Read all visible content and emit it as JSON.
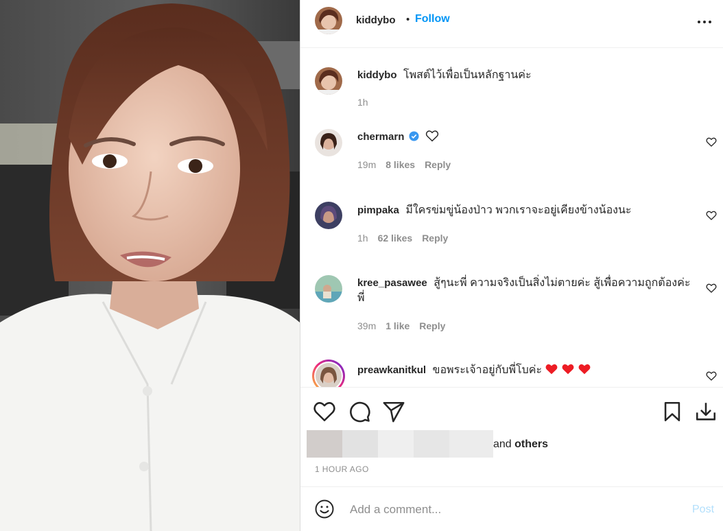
{
  "header": {
    "username": "kiddybo",
    "separator": "•",
    "follow_label": "Follow",
    "more_icon": "more-horizontal-icon"
  },
  "caption": {
    "username": "kiddybo",
    "text": "โพสต์ไว้เพื่อเป็นหลักฐานค่ะ",
    "time": "1h"
  },
  "comments": [
    {
      "username": "chermarn",
      "text": "",
      "verified": true,
      "emoji": "outline-heart",
      "time": "19m",
      "likes": "8 likes",
      "reply": "Reply"
    },
    {
      "username": "pimpaka",
      "text": "มีใครข่มขู่น้องป่าว พวกเราจะอยู่เคียงข้างน้องนะ",
      "time": "1h",
      "likes": "62 likes",
      "reply": "Reply"
    },
    {
      "username": "kree_pasawee",
      "text": "สู้ๆนะพี่ ความจริงเป็นสิ่งไม่ตายค่ะ สู้เพื่อความถูกต้องค่ะพี่",
      "time": "39m",
      "likes": "1 like",
      "reply": "Reply"
    },
    {
      "username": "preawkanitkul",
      "text": "ขอพระเจ้าอยู่กับพี่โบค่ะ",
      "emoji": "red-hearts",
      "time": "",
      "likes": "",
      "reply": ""
    }
  ],
  "actions": {
    "like_icon": "heart-icon",
    "comment_icon": "comment-icon",
    "share_icon": "send-icon",
    "save_icon": "bookmark-icon",
    "download_icon": "download-icon"
  },
  "likes": {
    "and_text": "and",
    "others_text": "others"
  },
  "timestamp": "1 HOUR AGO",
  "add_comment": {
    "placeholder": "Add a comment...",
    "post_label": "Post"
  },
  "colors": {
    "follow": "#0095f6",
    "post_disabled": "#b2dffc",
    "red_heart": "#ed1c24",
    "verified": "#3897f0"
  }
}
